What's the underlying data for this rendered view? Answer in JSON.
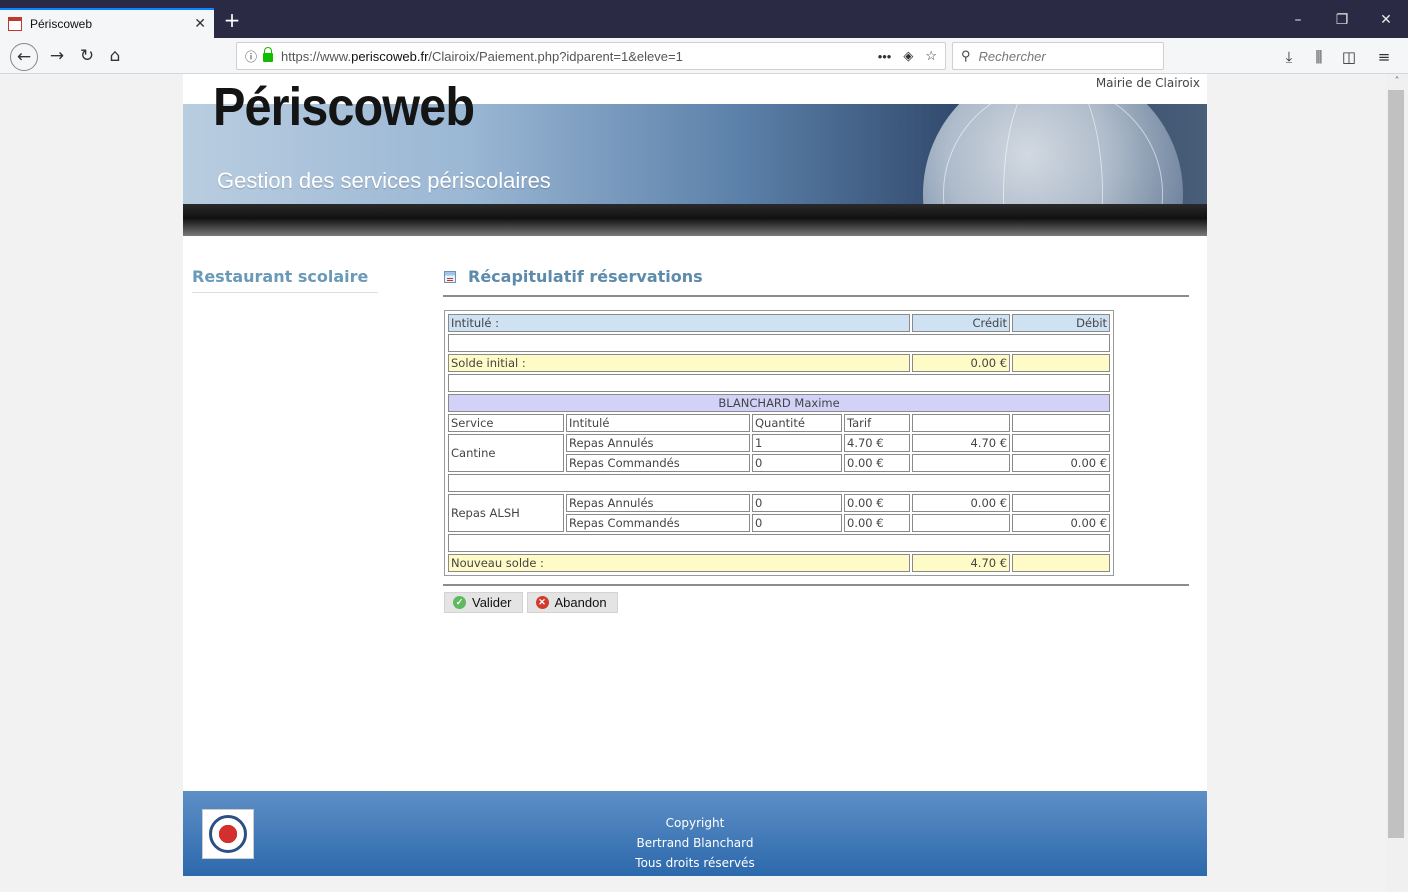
{
  "browser": {
    "tab_title": "Périscoweb",
    "url_host_prefix": "https://www.",
    "url_host": "periscoweb.fr",
    "url_path": "/Clairoix/Paiement.php?idparent=1&eleve=1",
    "search_placeholder": "Rechercher"
  },
  "header": {
    "mairie": "Mairie de Clairoix",
    "logo": "Périscoweb",
    "subtitle": "Gestion des services périscolaires"
  },
  "sidebar": {
    "title": "Restaurant scolaire"
  },
  "main": {
    "title": "Récapitulatif réservations"
  },
  "table": {
    "col_intitule": "Intitulé :",
    "col_credit": "Crédit",
    "col_debit": "Débit",
    "solde_initial_label": "Solde initial :",
    "solde_initial_credit": "0.00 €",
    "child_name": "BLANCHARD Maxime",
    "sub_headers": {
      "service": "Service",
      "intitule": "Intitulé",
      "quantite": "Quantité",
      "tarif": "Tarif"
    },
    "cantine": {
      "service": "Cantine",
      "rows": [
        {
          "intitule": "Repas Annulés",
          "quantite": "1",
          "tarif": "4.70 €",
          "credit": "4.70 €",
          "debit": ""
        },
        {
          "intitule": "Repas Commandés",
          "quantite": "0",
          "tarif": "0.00 €",
          "credit": "",
          "debit": "0.00 €"
        }
      ]
    },
    "alsh": {
      "service": "Repas ALSH",
      "rows": [
        {
          "intitule": "Repas Annulés",
          "quantite": "0",
          "tarif": "0.00 €",
          "credit": "0.00 €",
          "debit": ""
        },
        {
          "intitule": "Repas Commandés",
          "quantite": "0",
          "tarif": "0.00 €",
          "credit": "",
          "debit": "0.00 €"
        }
      ]
    },
    "nouveau_solde_label": "Nouveau solde :",
    "nouveau_solde_credit": "4.70 €"
  },
  "buttons": {
    "valider": "Valider",
    "abandon": "Abandon"
  },
  "footer": {
    "line1": "Copyright",
    "line2": "Bertrand Blanchard",
    "line3": "Tous droits réservés"
  }
}
